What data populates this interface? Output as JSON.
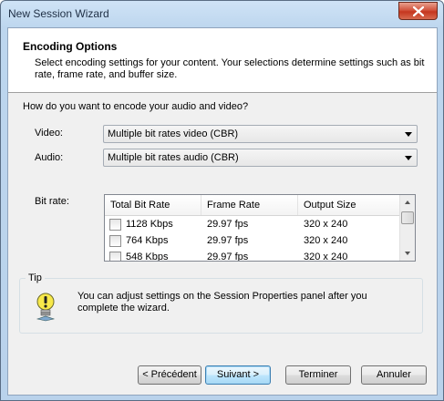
{
  "window": {
    "title": "New Session Wizard",
    "close_label": "close"
  },
  "header": {
    "title": "Encoding Options",
    "description": "Select encoding settings for your content. Your selections determine settings such as bit rate, frame rate, and buffer size."
  },
  "form": {
    "question": "How do you want to encode your audio and video?",
    "video_label": "Video:",
    "video_value": "Multiple bit rates video (CBR)",
    "audio_label": "Audio:",
    "audio_value": "Multiple bit rates audio (CBR)",
    "bitrate_label": "Bit rate:"
  },
  "bitrate_table": {
    "columns": [
      "Total Bit Rate",
      "Frame Rate",
      "Output Size"
    ],
    "rows": [
      {
        "checked": false,
        "bitrate": "1128 Kbps",
        "frame_rate": "29.97 fps",
        "output_size": "320 x 240"
      },
      {
        "checked": false,
        "bitrate": "764 Kbps",
        "frame_rate": "29.97 fps",
        "output_size": "320 x 240"
      },
      {
        "checked": false,
        "bitrate": "548 Kbps",
        "frame_rate": "29.97 fps",
        "output_size": "320 x 240"
      }
    ]
  },
  "tip": {
    "label": "Tip",
    "text": "You can adjust settings on the Session Properties panel after you complete the wizard."
  },
  "buttons": {
    "back": "< Précédent",
    "next": "Suivant >",
    "finish": "Terminer",
    "cancel": "Annuler"
  },
  "icons": {
    "close": "close-icon",
    "tip": "lightbulb-tip-icon",
    "dropdown": "chevron-down-icon"
  }
}
